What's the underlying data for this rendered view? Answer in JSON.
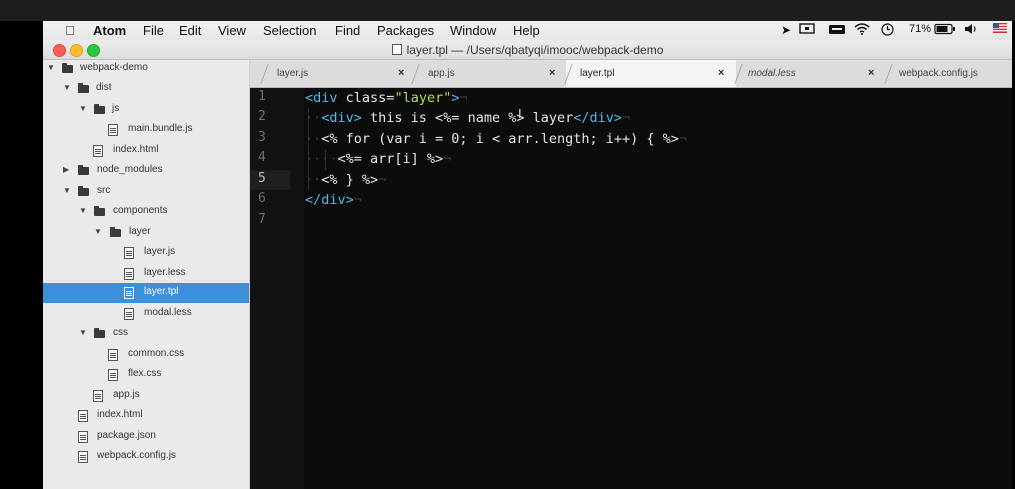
{
  "menubar": {
    "app": "Atom",
    "items": [
      "File",
      "Edit",
      "View",
      "Selection",
      "Find",
      "Packages",
      "Window",
      "Help"
    ],
    "battery": "71%"
  },
  "window": {
    "title": "layer.tpl — /Users/qbatyqi/imooc/webpack-demo"
  },
  "tree": [
    {
      "label": "webpack-demo",
      "kind": "folder",
      "expanded": true
    },
    {
      "label": "dist",
      "kind": "folder",
      "expanded": true
    },
    {
      "label": "js",
      "kind": "folder",
      "expanded": true
    },
    {
      "label": "main.bundle.js",
      "kind": "file"
    },
    {
      "label": "index.html",
      "kind": "file"
    },
    {
      "label": "node_modules",
      "kind": "folder",
      "expanded": false
    },
    {
      "label": "src",
      "kind": "folder",
      "expanded": true
    },
    {
      "label": "components",
      "kind": "folder",
      "expanded": true
    },
    {
      "label": "layer",
      "kind": "folder",
      "expanded": true
    },
    {
      "label": "layer.js",
      "kind": "file"
    },
    {
      "label": "layer.less",
      "kind": "file"
    },
    {
      "label": "layer.tpl",
      "kind": "file",
      "selected": true
    },
    {
      "label": "modal.less",
      "kind": "file"
    },
    {
      "label": "css",
      "kind": "folder",
      "expanded": true
    },
    {
      "label": "common.css",
      "kind": "file"
    },
    {
      "label": "flex.css",
      "kind": "file"
    },
    {
      "label": "app.js",
      "kind": "file"
    },
    {
      "label": "index.html",
      "kind": "file"
    },
    {
      "label": "package.json",
      "kind": "file"
    },
    {
      "label": "webpack.config.js",
      "kind": "file"
    }
  ],
  "tabs": [
    {
      "label": "layer.js",
      "active": false
    },
    {
      "label": "app.js",
      "active": false
    },
    {
      "label": "layer.tpl",
      "active": true
    },
    {
      "label": "modal.less",
      "active": false,
      "italic": true
    },
    {
      "label": "webpack.config.js",
      "active": false
    }
  ],
  "tab_close_glyph": "×",
  "editor": {
    "line_numbers": [
      "1",
      "2",
      "3",
      "4",
      "5",
      "6",
      "7"
    ],
    "current_line": "5",
    "lines": [
      "<div class=\"layer\">",
      "  <div> this is <%= name %> layer</div>",
      "  <% for (var i = 0; i < arr.length; i++) { %>",
      "    <%= arr[i] %>",
      "  <% } %>",
      "</div>",
      ""
    ]
  },
  "colors": {
    "tag": "#4fb9ec",
    "string": "#a8e04a",
    "selection": "#3d8fdb",
    "editor_bg": "#0c0c0c"
  }
}
